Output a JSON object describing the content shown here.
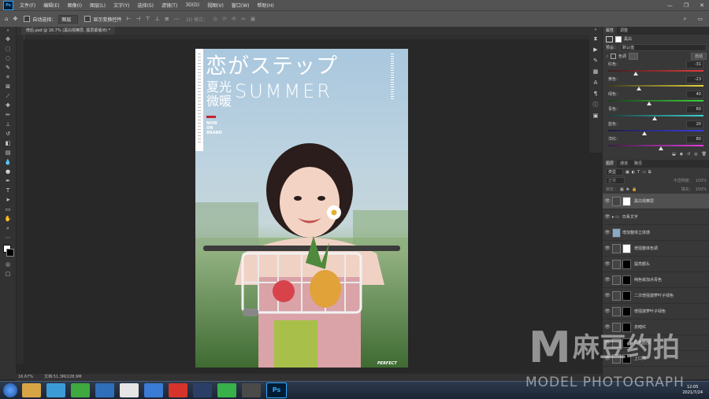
{
  "menu": {
    "logo": "Ps",
    "items": [
      "文件(F)",
      "编辑(E)",
      "图像(I)",
      "图层(L)",
      "文字(Y)",
      "选择(S)",
      "滤镜(T)",
      "3D(D)",
      "视图(V)",
      "窗口(W)",
      "帮助(H)"
    ],
    "window_controls": [
      "—",
      "❐",
      "✕"
    ]
  },
  "options": {
    "auto_select_label": "自动选择：",
    "auto_select_value": "图层",
    "transform_label": "显示变换控件",
    "mode_3d_label": "3D 模式："
  },
  "document": {
    "tab_title": "修后.psd @ 16.7% (黑白观察层, 图层蒙版/8) *",
    "zoom": "16.67%",
    "doc_size": "文档:51.3M/228.9M"
  },
  "poster": {
    "title_jp": "恋がステップ",
    "title_cn_1": "夏光",
    "title_cn_2": "微暖",
    "title_en": "SUMMER",
    "brand_1": "NOW",
    "brand_2": "ON",
    "brand_3": "BRAND",
    "footer": "PERFECT"
  },
  "properties": {
    "tabs": [
      "属性",
      "调整"
    ],
    "panel_title": "黑白",
    "preset_label": "预设：",
    "preset_value": "默认值",
    "tint_label": "色调",
    "auto_label": "自动",
    "sliders": [
      {
        "label": "红色：",
        "value": "-31",
        "pct": 0.29,
        "gradient": "linear-gradient(90deg,#3a1f1f,#e23b3b)"
      },
      {
        "label": "黄色：",
        "value": "-23",
        "pct": 0.32,
        "gradient": "linear-gradient(90deg,#3a3a1f,#e6d23b)"
      },
      {
        "label": "绿色：",
        "value": "40",
        "pct": 0.43,
        "gradient": "linear-gradient(90deg,#1f3a1f,#3bd23b)"
      },
      {
        "label": "青色：",
        "value": "60",
        "pct": 0.49,
        "gradient": "linear-gradient(90deg,#1f3a3a,#3bd2d2)"
      },
      {
        "label": "蓝色：",
        "value": "20",
        "pct": 0.38,
        "gradient": "linear-gradient(90deg,#1f1f3a,#3b3be2)"
      },
      {
        "label": "洋红：",
        "value": "80",
        "pct": 0.55,
        "gradient": "linear-gradient(90deg,#3a1f3a,#e23be2)"
      }
    ]
  },
  "layers_panel": {
    "tabs": [
      "图层",
      "通道",
      "路径"
    ],
    "kind_filter": "类型",
    "blend_mode": "正常",
    "opacity_label": "不透明度：",
    "opacity_value": "100%",
    "lock_label": "锁定：",
    "fill_label": "填充：",
    "fill_value": "100%",
    "layers": [
      {
        "name": "黑白观察层",
        "selected": true,
        "type": "adj",
        "mask": "white"
      },
      {
        "name": "日系文字",
        "selected": false,
        "type": "group",
        "mask": "none"
      },
      {
        "name": "增加整体立体感",
        "selected": false,
        "type": "photo",
        "mask": "none"
      },
      {
        "name": "增强整体色调",
        "selected": false,
        "type": "adj",
        "mask": "white"
      },
      {
        "name": "提亮额头",
        "selected": false,
        "type": "adj",
        "mask": "black"
      },
      {
        "name": "纯色就加点青色",
        "selected": false,
        "type": "adj",
        "mask": "black"
      },
      {
        "name": "二次增强菠萝叶子绿色",
        "selected": false,
        "type": "adj",
        "mask": "black"
      },
      {
        "name": "增强菠萝叶子绿色",
        "selected": false,
        "type": "adj",
        "mask": "black"
      },
      {
        "name": "去暗红",
        "selected": false,
        "type": "adj",
        "mask": "black"
      },
      {
        "name": "提亮脸部",
        "selected": false,
        "type": "adj",
        "mask": "black"
      },
      {
        "name": "上口红",
        "selected": false,
        "type": "adj",
        "mask": "black"
      }
    ]
  },
  "taskbar": {
    "apps": [
      "",
      "",
      "",
      "",
      "",
      "",
      "",
      "",
      "",
      "",
      "Ps"
    ],
    "time": "12:05",
    "date": "2021/7/24"
  },
  "watermark": {
    "logo_letter": "M",
    "text_cn": "麻豆约拍",
    "text_en": "MODEL PHOTOGRAPH"
  },
  "colors": {
    "accent_red": "#c0272d",
    "ps_blue": "#31a8ff"
  }
}
